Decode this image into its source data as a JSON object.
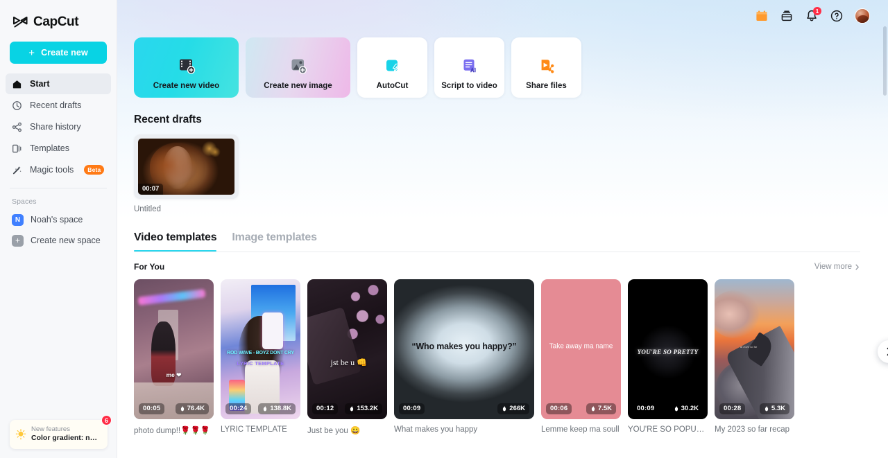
{
  "brand": {
    "name": "CapCut"
  },
  "sidebar": {
    "create_new_label": "Create new",
    "items": [
      {
        "label": "Start",
        "icon": "home-icon"
      },
      {
        "label": "Recent drafts",
        "icon": "clock-icon"
      },
      {
        "label": "Share history",
        "icon": "share-icon"
      },
      {
        "label": "Templates",
        "icon": "templates-icon"
      },
      {
        "label": "Magic tools",
        "icon": "magic-wand-icon",
        "badge": "Beta"
      }
    ],
    "spaces_label": "Spaces",
    "spaces": [
      {
        "label": "Noah's space",
        "initial": "N"
      },
      {
        "label": "Create new space",
        "initial": "+"
      }
    ],
    "promo": {
      "title": "New features",
      "subtitle": "Color gradient: new…",
      "badge": "6",
      "icon": "lightbulb-icon"
    }
  },
  "topbar": {
    "icons": [
      {
        "name": "gift-icon"
      },
      {
        "name": "storage-box-icon"
      },
      {
        "name": "bell-icon",
        "badge": "1"
      },
      {
        "name": "help-circle-icon"
      },
      {
        "name": "avatar"
      }
    ]
  },
  "actions": [
    {
      "label": "Create new video",
      "icon": "film-plus-icon",
      "style": "c-video"
    },
    {
      "label": "Create new image",
      "icon": "image-plus-icon",
      "style": "c-image"
    },
    {
      "label": "AutoCut",
      "icon": "autocut-icon",
      "style": "plain"
    },
    {
      "label": "Script to video",
      "icon": "script-ai-icon",
      "style": "plain"
    },
    {
      "label": "Share files",
      "icon": "share-files-icon",
      "style": "plain"
    }
  ],
  "recent_drafts": {
    "title": "Recent drafts",
    "items": [
      {
        "name": "Untitled",
        "duration": "00:07"
      }
    ]
  },
  "templates_section": {
    "tabs": [
      {
        "label": "Video templates",
        "active": true
      },
      {
        "label": "Image templates",
        "active": false
      }
    ],
    "row_title": "For You",
    "view_more_label": "View more",
    "next_arrow": "chevron-right-icon",
    "items": [
      {
        "name": "photo dump!!🌹🌹🌹",
        "duration": "00:05",
        "uses": "76.4K",
        "overlay": "me ❤",
        "art": "t1"
      },
      {
        "name": "LYRIC TEMPLATE",
        "duration": "00:24",
        "uses": "138.8K",
        "overlay_line1": "ROD WAVE - BOYZ DONT CRY",
        "overlay_line2": "LYRIC TEMPLATE",
        "art": "t2"
      },
      {
        "name": "Just be you 😀",
        "duration": "00:12",
        "uses": "153.2K",
        "overlay": "jst be u 👊",
        "art": "t3"
      },
      {
        "name": "What makes you happy",
        "duration": "00:09",
        "uses": "266K",
        "overlay": "“Who makes you happy?”",
        "art": "t4"
      },
      {
        "name": "Lemme keep ma soull",
        "duration": "00:06",
        "uses": "7.5K",
        "overlay": "Take away ma name",
        "art": "t5"
      },
      {
        "name": "YOU'RE SO POPULAR",
        "duration": "00:09",
        "uses": "30.2K",
        "overlay": "YOU'RE SO PRETTY",
        "art": "t6"
      },
      {
        "name": "My 2023 so far recap",
        "duration": "00:28",
        "uses": "5.3K",
        "overlay": "at 2023 so far",
        "art": "t7"
      }
    ]
  },
  "colors": {
    "accent_cyan": "#2ad7ee",
    "create_button": "#08d3e4",
    "badge_red": "#ff2d46",
    "beta_orange": "#ff7a15",
    "space_blue": "#4080ff"
  }
}
